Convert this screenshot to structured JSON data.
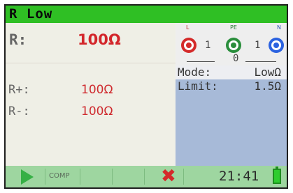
{
  "header": {
    "title": "R Low"
  },
  "measurement": {
    "r_label": "R:",
    "r_value": "100Ω",
    "r_plus_label": "R+:",
    "r_plus_value": "100Ω",
    "r_minus_label": "R-:",
    "r_minus_value": "100Ω"
  },
  "connection": {
    "terminals": [
      {
        "label": "L",
        "color": "#d42a2a",
        "icon": "terminal-l-icon"
      },
      {
        "label": "PE",
        "color": "#2a8e3c",
        "icon": "terminal-pe-icon"
      },
      {
        "label": "N",
        "color": "#2b62e0",
        "icon": "terminal-n-icon"
      }
    ],
    "values": [
      "1",
      "0",
      "1"
    ]
  },
  "settings": {
    "mode_label": "Mode:",
    "mode_value": "LowΩ",
    "limit_label": "Limit:",
    "limit_value": "1.5Ω"
  },
  "toolbar": {
    "start_icon": "play-icon",
    "comp_label": "COMP",
    "cancel_icon": "x-icon",
    "time": "21:41",
    "battery_icon": "battery-icon",
    "accent_color": "#2fbf24"
  }
}
